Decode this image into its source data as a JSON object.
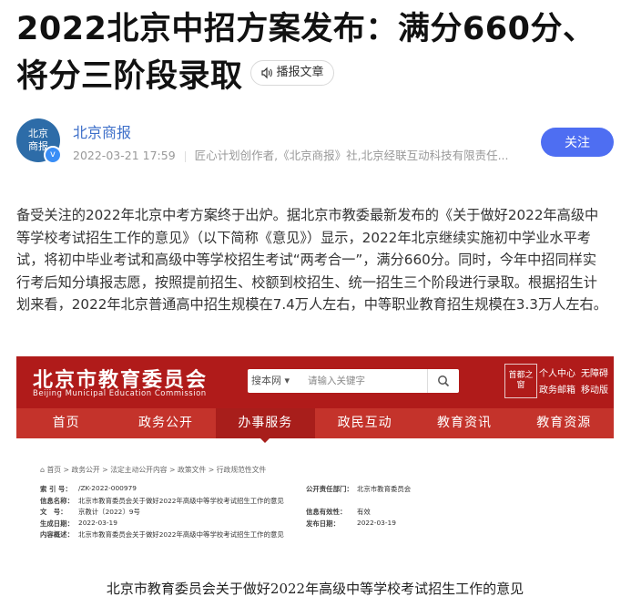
{
  "article": {
    "title": "2022北京中招方案发布：满分660分、将分三阶段录取",
    "speak_label": "播报文章",
    "body": "备受关注的2022年北京中考方案终于出炉。据北京市教委最新发布的《关于做好2022年高级中等学校考试招生工作的意见》（以下简称《意见》）显示，2022年北京继续实施初中学业水平考试，将初中毕业考试和高级中等学校招生考试“两考合一”，满分660分。同时，今年中招同样实行考后知分填报志愿，按照提前招生、校额到校招生、统一招生三个阶段进行录取。根据招生计划来看，2022年北京普通高中招生规模在7.4万人左右，中等职业教育招生规模在3.3万人左右。"
  },
  "author": {
    "name": "北京商报",
    "avatar_text": "北京商报",
    "verified_mark": "v",
    "date": "2022-03-21 17:59",
    "description": "匠心计划创作者,《北京商报》社,北京经联互动科技有限责任...",
    "follow_label": "关注"
  },
  "screenshot": {
    "site_name": "北京市教育委员会",
    "site_name_en": "Beijing Municipal Education Commission",
    "search_scope": "搜本网",
    "search_placeholder": "请输入关键字",
    "logo_text": "首都之窗",
    "links": [
      "个人中心",
      "无障碍",
      "政务邮箱",
      "移动版"
    ],
    "nav": [
      "首页",
      "政务公开",
      "办事服务",
      "政民互动",
      "教育资讯",
      "教育资源"
    ],
    "breadcrumb": "首页 > 政务公开 > 法定主动公开内容 > 政策文件 > 行政规范性文件",
    "rows": [
      {
        "k": "索 引 号：",
        "v": "/ZK-2022-000979",
        "k2": "公开责任部门：",
        "v2": "北京市教育委员会"
      },
      {
        "k": "信息名称：",
        "v": "北京市教育委员会关于做好2022年高级中等学校考试招生工作的意见",
        "k2": "",
        "v2": ""
      },
      {
        "k": "文　号：",
        "v": "京教计〔2022〕9号",
        "k2": "信息有效性：",
        "v2": "有效"
      },
      {
        "k": "生成日期：",
        "v": "2022-03-19",
        "k2": "发布日期：",
        "v2": "2022-03-19"
      },
      {
        "k": "内容概述：",
        "v": "北京市教育委员会关于做好2022年高级中等学校考试招生工作的意见",
        "k2": "",
        "v2": ""
      }
    ],
    "doc_title": "北京市教育委员会关于做好2022年高级中等学校考试招生工作的意见"
  },
  "colors": {
    "accent": "#4e6ef2",
    "site_red": "#b01b1a",
    "author_blue": "#3d6fc9"
  }
}
